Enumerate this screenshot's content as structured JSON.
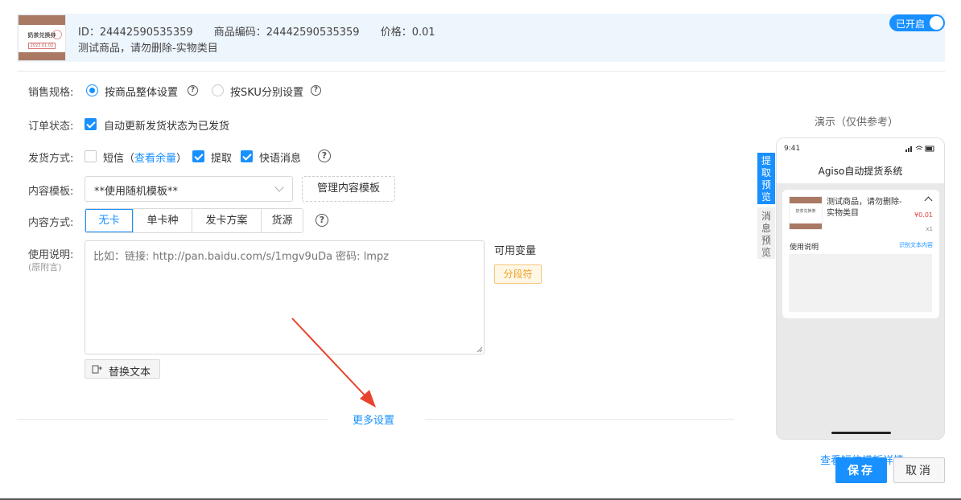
{
  "header": {
    "thumb": {
      "title": "奶茶兑换券",
      "date": "2022.01.02"
    },
    "id_text": "ID：24442590535359",
    "code_text": "商品编码：24442590535359",
    "price_text": "价格：0.01",
    "product_name": "测试商品，请勿删除-实物类目",
    "toggle_label": "已开启"
  },
  "form": {
    "sale_spec": {
      "label": "销售规格:",
      "options": [
        {
          "label": "按商品整体设置",
          "selected": true
        },
        {
          "label": "按SKU分别设置",
          "selected": false
        }
      ]
    },
    "order_status": {
      "label": "订单状态:",
      "checkbox_label": "自动更新发货状态为已发货",
      "checked": true
    },
    "delivery": {
      "label": "发货方式:",
      "sms_label": "短信（",
      "sms_link": "查看余量",
      "sms_close": "）",
      "pickup_label": "提取",
      "quick_label": "快语消息"
    },
    "template": {
      "label": "内容模板:",
      "value": "**使用随机模板**",
      "manage_button": "管理内容模板"
    },
    "content_mode": {
      "label": "内容方式:",
      "tabs": [
        "无卡",
        "单卡种",
        "发卡方案",
        "货源"
      ],
      "active": 0
    },
    "usage": {
      "label": "使用说明:",
      "sublabel": "(原附言)",
      "placeholder": "比如：链接: http://pan.baidu.com/s/1mgv9uDa 密码: lmpz",
      "replace_button": "替换文本"
    },
    "variables": {
      "title": "可用变量",
      "chip": "分段符"
    },
    "more_settings": "更多设置"
  },
  "preview": {
    "title": "演示（仅供参考）",
    "tab_pickup": "提取预览",
    "tab_message": "消息预览",
    "phone": {
      "time": "9:41",
      "nav_title": "Agiso自动提货系统",
      "product_name": "测试商品，请勿删除-实物类目",
      "price": "¥0.01",
      "qty": "x1",
      "usage_label": "使用说明",
      "detail_link": "识别文本内容"
    },
    "view_link": "查看短信模板详情"
  },
  "actions": {
    "save": "保存",
    "cancel": "取消"
  },
  "colors": {
    "primary": "#1890ff",
    "header_bg": "#edf5fd",
    "chip_text": "#f0a020",
    "annotation_arrow": "#e8432d"
  }
}
